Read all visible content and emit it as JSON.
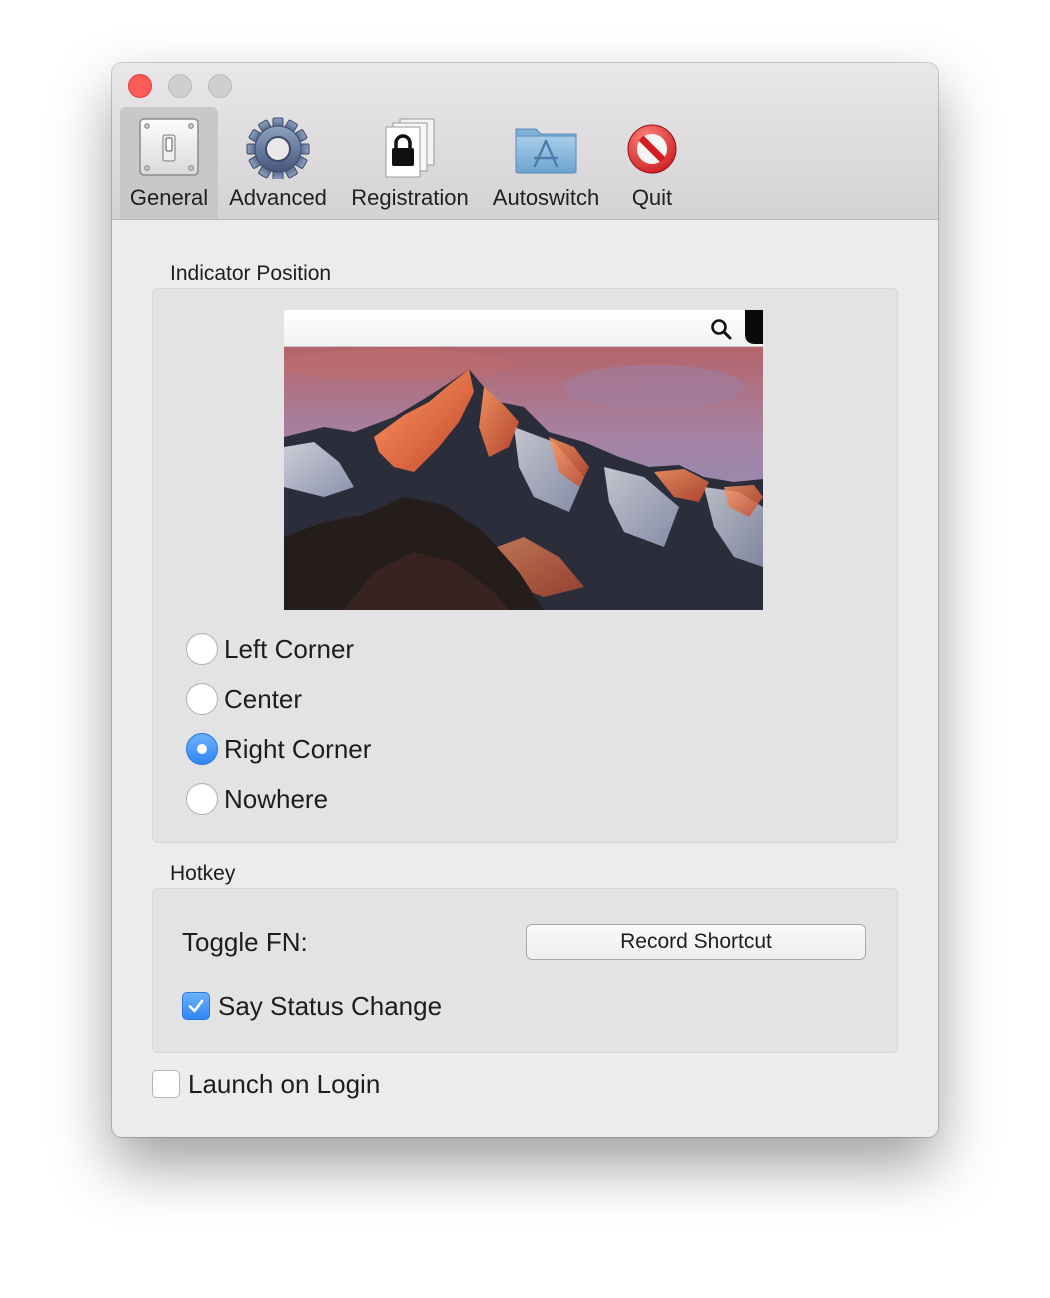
{
  "toolbar": {
    "tabs": [
      {
        "label": "General",
        "icon": "toggle-switch-icon",
        "selected": true
      },
      {
        "label": "Advanced",
        "icon": "gear-icon",
        "selected": false
      },
      {
        "label": "Registration",
        "icon": "lock-documents-icon",
        "selected": false
      },
      {
        "label": "Autoswitch",
        "icon": "app-folder-icon",
        "selected": false
      },
      {
        "label": "Quit",
        "icon": "prohibited-icon",
        "selected": false
      }
    ]
  },
  "indicator": {
    "section_label": "Indicator Position",
    "options": [
      {
        "label": "Left Corner",
        "checked": false
      },
      {
        "label": "Center",
        "checked": false
      },
      {
        "label": "Right Corner",
        "checked": true
      },
      {
        "label": "Nowhere",
        "checked": false
      }
    ]
  },
  "hotkey": {
    "section_label": "Hotkey",
    "toggle_label": "Toggle FN:",
    "record_button": "Record Shortcut",
    "say_status": {
      "label": "Say Status Change",
      "checked": true
    }
  },
  "launch_on_login": {
    "label": "Launch on Login",
    "checked": false
  },
  "colors": {
    "accent": "#3a8ef6",
    "close": "#fc5b57",
    "window_bg": "#ececec"
  }
}
